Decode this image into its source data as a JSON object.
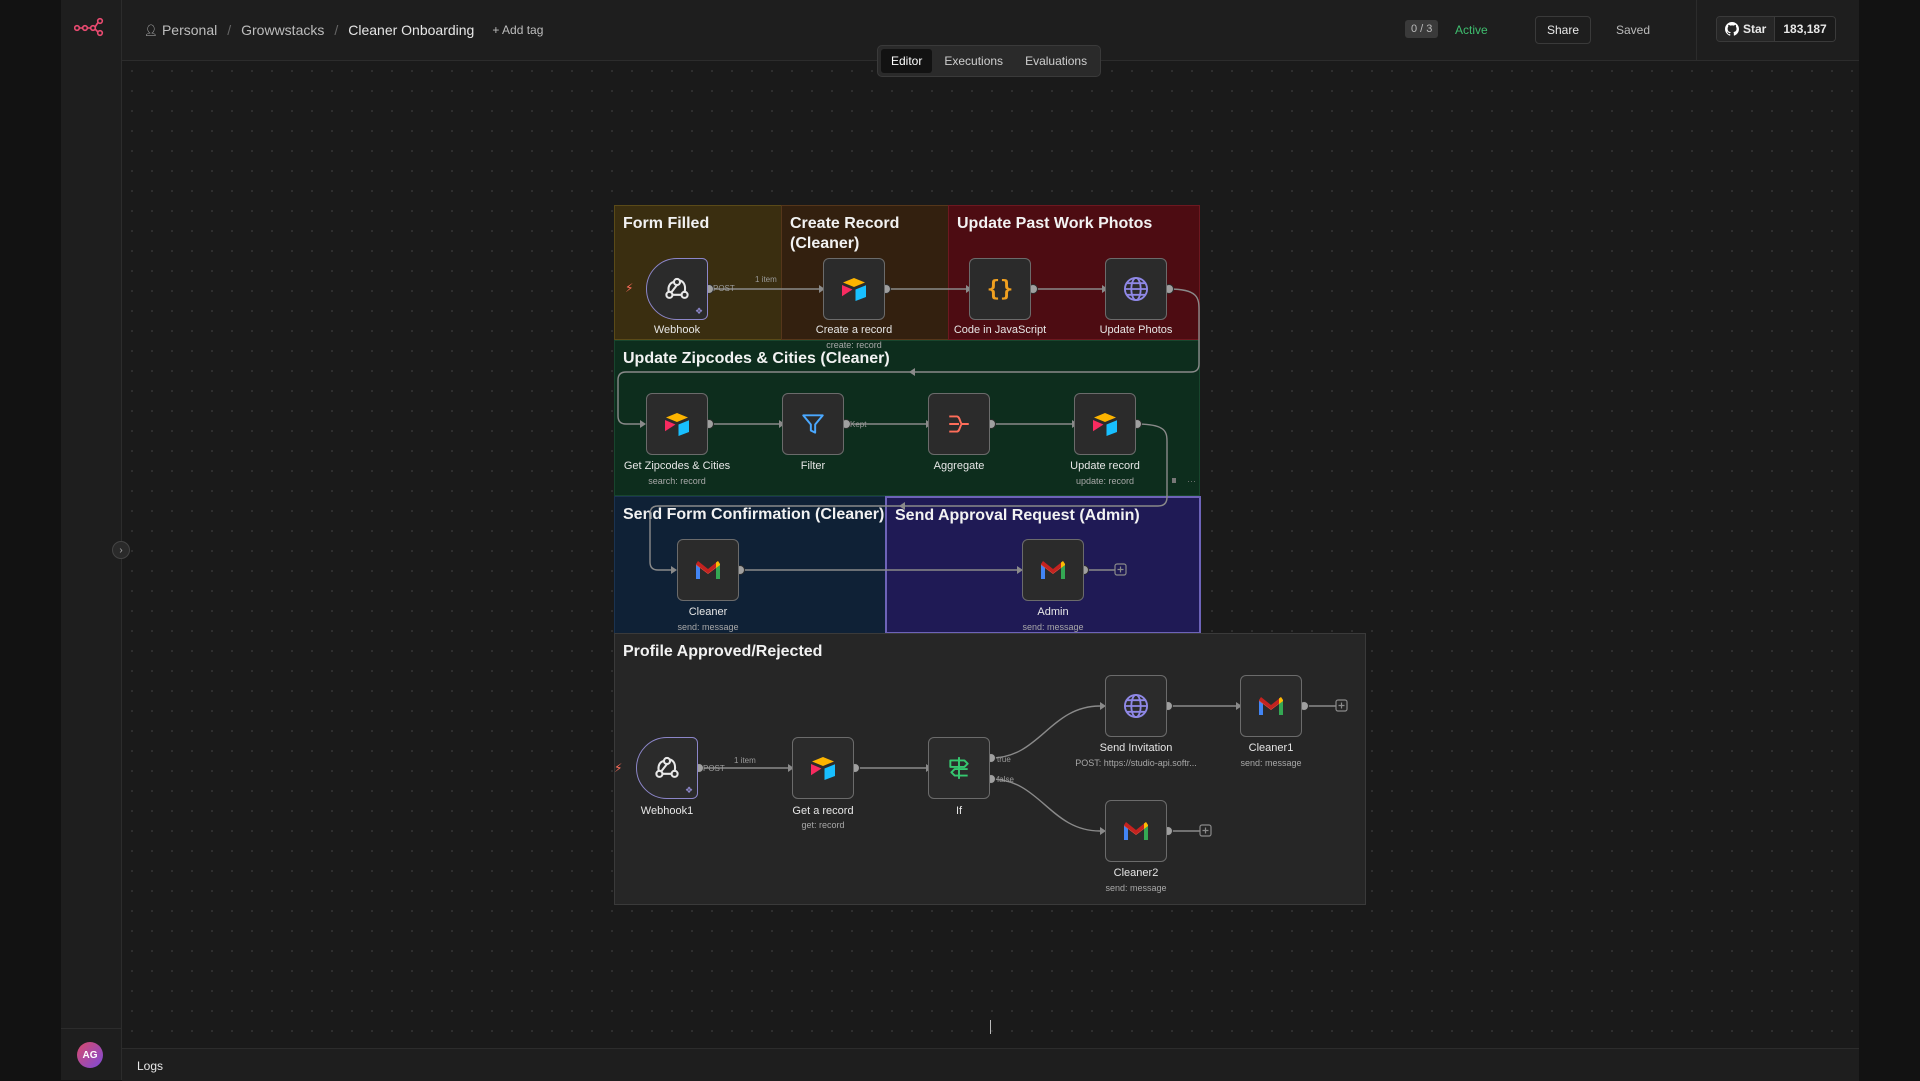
{
  "breadcrumb": {
    "owner": "Personal",
    "folder": "Growwstacks",
    "workflow": "Cleaner Onboarding",
    "add_tag": "+ Add tag"
  },
  "header": {
    "counter": "0 / 3",
    "status": "Active",
    "share": "Share",
    "saved": "Saved"
  },
  "github": {
    "star": "Star",
    "count": "183,187"
  },
  "tabs": [
    "Editor",
    "Executions",
    "Evaluations"
  ],
  "sticky_notes": {
    "form_filled": "Form Filled",
    "create_record": "Create Record (Cleaner)",
    "update_photos": "Update Past Work Photos",
    "update_zip": "Update Zipcodes & Cities (Cleaner)",
    "form_confirm": "Send Form Confirmation (Cleaner)",
    "approval": "Send Approval Request (Admin)",
    "profile": "Profile Approved/Rejected"
  },
  "nodes": {
    "webhook": {
      "label": "Webhook"
    },
    "create_record": {
      "label": "Create a record",
      "sub": "create: record"
    },
    "code_js": {
      "label": "Code in JavaScript"
    },
    "update_photos": {
      "label": "Update Photos"
    },
    "get_zip": {
      "label": "Get Zipcodes & Cities",
      "sub": "search: record"
    },
    "filter": {
      "label": "Filter"
    },
    "aggregate": {
      "label": "Aggregate"
    },
    "update_record": {
      "label": "Update record",
      "sub": "update: record"
    },
    "cleaner": {
      "label": "Cleaner",
      "sub": "send: message"
    },
    "admin": {
      "label": "Admin",
      "sub": "send: message"
    },
    "webhook1": {
      "label": "Webhook1"
    },
    "get_record": {
      "label": "Get a record",
      "sub": "get: record"
    },
    "if": {
      "label": "If"
    },
    "send_invitation": {
      "label": "Send Invitation",
      "sub": "POST: https://studio-api.softr..."
    },
    "cleaner1": {
      "label": "Cleaner1",
      "sub": "send: message"
    },
    "cleaner2": {
      "label": "Cleaner2",
      "sub": "send: message"
    }
  },
  "wire_labels": {
    "post": "POST",
    "one_item": "1 item",
    "kept": "Kept",
    "true_lbl": "true",
    "false_lbl": "false"
  },
  "user": {
    "initials": "AG"
  },
  "logs": {
    "label": "Logs"
  },
  "colors": {
    "accent": "#ff6d5a",
    "active": "#3fbe6f",
    "trigger_border": "#8c86c9"
  }
}
